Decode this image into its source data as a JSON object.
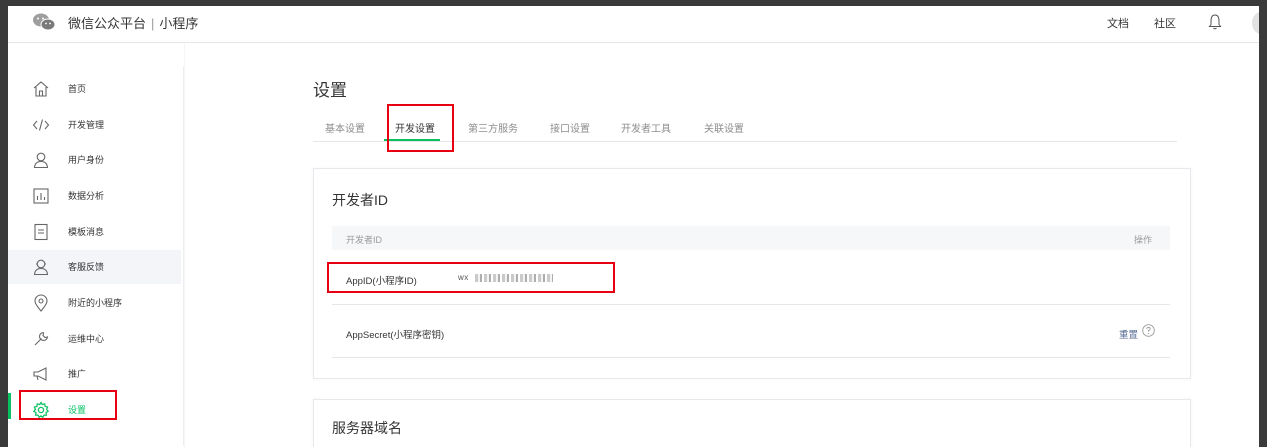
{
  "header": {
    "brand": "微信公众平台",
    "separator": "|",
    "product": "小程序",
    "links": [
      "文档",
      "社区"
    ]
  },
  "sidebar": {
    "items": [
      {
        "label": "首页",
        "icon": "home-icon"
      },
      {
        "label": "开发管理",
        "icon": "code-icon"
      },
      {
        "label": "用户身份",
        "icon": "user-icon"
      },
      {
        "label": "数据分析",
        "icon": "chart-icon"
      },
      {
        "label": "模板消息",
        "icon": "document-icon"
      },
      {
        "label": "客服反馈",
        "icon": "support-icon"
      },
      {
        "label": "附近的小程序",
        "icon": "location-icon"
      },
      {
        "label": "运维中心",
        "icon": "wrench-icon"
      },
      {
        "label": "推广",
        "icon": "megaphone-icon"
      },
      {
        "label": "设置",
        "icon": "gear-icon"
      }
    ],
    "active": "设置"
  },
  "main": {
    "title": "设置",
    "tabs": [
      "基本设置",
      "开发设置",
      "第三方服务",
      "接口设置",
      "开发者工具",
      "关联设置"
    ],
    "active_tab": "开发设置",
    "developer_card": {
      "title": "开发者ID",
      "table_header": {
        "col1": "开发者ID",
        "col2": "操作"
      },
      "rows": [
        {
          "label": "AppID(小程序ID)",
          "value": "wx"
        },
        {
          "label": "AppSecret(小程序密钥)",
          "action": "重置"
        }
      ]
    },
    "server_card": {
      "title": "服务器域名"
    }
  },
  "colors": {
    "accent": "#07c160",
    "highlight": "#e60012",
    "link": "#576b95"
  }
}
